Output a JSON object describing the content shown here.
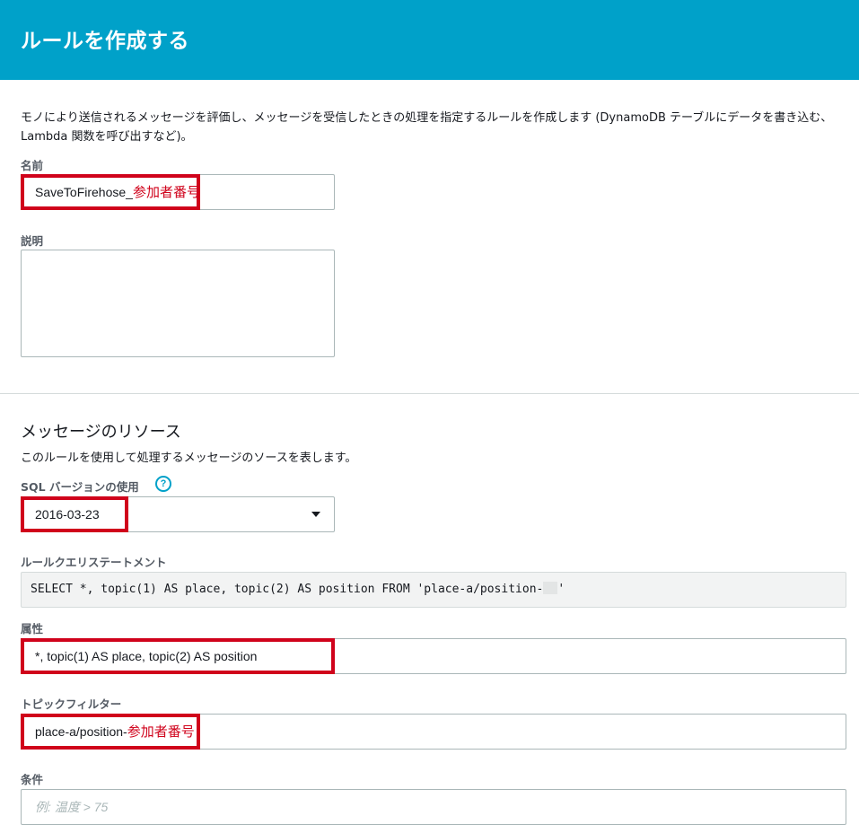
{
  "header": {
    "title": "ルールを作成する"
  },
  "intro": {
    "text": "モノにより送信されるメッセージを評価し、メッセージを受信したときの処理を指定するルールを作成します (DynamoDB テーブルにデータを書き込む、Lambda 関数を呼び出すなど)。"
  },
  "name_field": {
    "label": "名前",
    "value": "SaveToFirehose_",
    "annotation": "参加者番号"
  },
  "description_field": {
    "label": "説明",
    "value": ""
  },
  "message_source": {
    "title": "メッセージのリソース",
    "description": "このルールを使用して処理するメッセージのソースを表します。"
  },
  "sql_version": {
    "label": "SQL バージョンの使用",
    "help_icon": "?",
    "selected": "2016-03-23"
  },
  "query_statement": {
    "label": "ルールクエリステートメント",
    "prefix": "SELECT *, topic(1) AS place, topic(2) AS position FROM 'place-a/position-",
    "suffix": "'"
  },
  "attribute_field": {
    "label": "属性",
    "value": "*, topic(1) AS place, topic(2) AS position"
  },
  "topic_filter_field": {
    "label": "トピックフィルター",
    "value": "place-a/position-",
    "annotation": "参加者番号"
  },
  "condition_field": {
    "label": "条件",
    "placeholder": "例: 温度 > 75"
  },
  "colors": {
    "header_bg": "#00a1c9",
    "annotation_red": "#d0021b",
    "help_icon": "#00a1c9"
  }
}
